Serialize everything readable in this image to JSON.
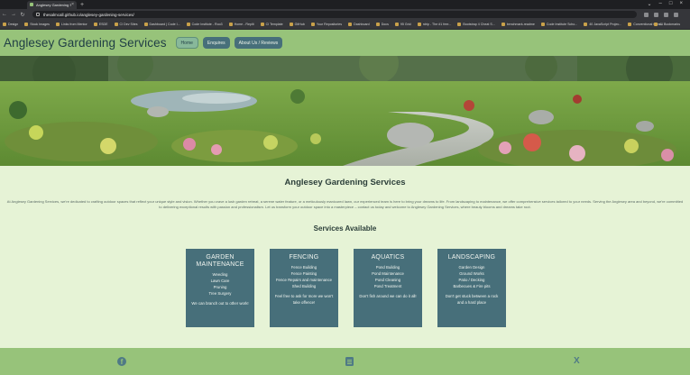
{
  "browser": {
    "tab_title": "Anglesey Gardening Services",
    "url": "thesalmcall.github.io/anglesey-gardening-services/",
    "bookmarks": [
      "Design",
      "Stock Images",
      "Links from Mentor",
      "ESDE",
      "CI Dev Sites",
      "Dashboard | Code I...",
      "Code Institute - Roo3",
      "Home - Replit",
      "CI Template",
      "GitHub",
      "Your Repositories",
      "Dashboard",
      "Docs",
      "95 Grid",
      "rdrip - The #1 free...",
      "Bootstrap 4 Cheat S...",
      "benchmark-readme",
      "Code Institute Scho...",
      "40 JavaScript Projec...",
      "Conventional Com..."
    ],
    "all_bookmarks": "All Bookmarks"
  },
  "header": {
    "brand": "Anglesey Gardening Services",
    "nav": [
      "Home",
      "Enquires",
      "About Us / Reviews"
    ]
  },
  "intro": {
    "title": "Anglesey Gardening Services",
    "text": "At Anglesey Gardening Services, we're dedicated to crafting outdoor spaces that reflect your unique style and vision. Whether you crave a lush garden retreat, a serene water feature, or a meticulously manicured lawn, our experienced team is here to bring your dreams to life. From landscaping to maintenance, we offer comprehensive services tailored to your needs. Serving the Anglesey area and beyond, we're committed to delivering exceptional results with passion and professionalism. Let us transform your outdoor space into a masterpiece – contact us today and welcome to Anglesey Gardening Services, where beauty blooms and dreams take root."
  },
  "services": {
    "title": "Services Available",
    "cards": [
      {
        "title": "GARDEN MAINTENANCE",
        "items": [
          "Weeding",
          "Lawn Care",
          "Pruning",
          "Tree Surgery"
        ],
        "note": "We can branch out to other work!"
      },
      {
        "title": "FENCING",
        "items": [
          "Fence Building",
          "Fence Painting",
          "Fence Repairs and maintenance",
          "Shed Building"
        ],
        "note": "Feel free to ask for more we won't take offence!"
      },
      {
        "title": "AQUATICS",
        "items": [
          "Pond Building",
          "Pond Maintenance",
          "Pond Cleaning",
          "Pond Treatment"
        ],
        "note": "Don't fish around we can do it all!"
      },
      {
        "title": "LANDSCAPING",
        "items": [
          "Garden Design",
          "Ground Works",
          "Patio / Decking",
          "Barbecues & Fire pits"
        ],
        "note": "Don't get stuck between a rock and a hard place"
      }
    ]
  },
  "footer": {
    "icons": [
      "facebook-icon",
      "document-icon",
      "x-icon"
    ],
    "x_glyph": "X",
    "fb_glyph": "f"
  },
  "colors": {
    "header_bg": "#97c37a",
    "page_bg": "#e6f3d6",
    "card_bg": "#476f7a",
    "text_dark": "#2c3f3a"
  }
}
